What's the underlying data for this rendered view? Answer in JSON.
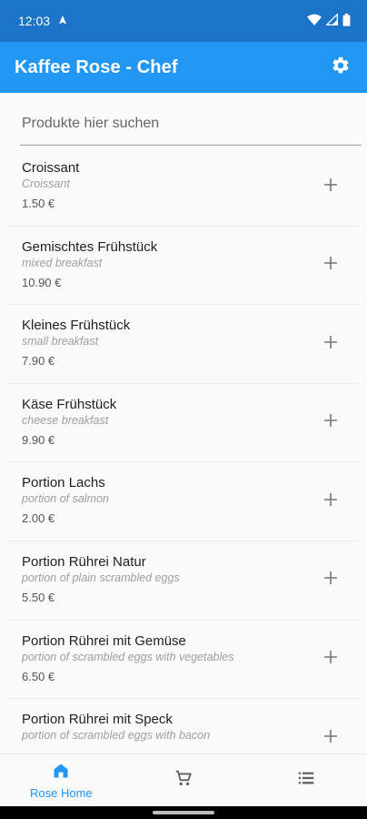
{
  "status_bar": {
    "time": "12:03",
    "icons": [
      "navigation-icon",
      "wifi-icon",
      "signal-icon",
      "battery-icon"
    ]
  },
  "app_bar": {
    "title": "Kaffee Rose - Chef",
    "settings_icon": "gear-icon"
  },
  "search": {
    "placeholder": "Produkte hier suchen",
    "value": ""
  },
  "products": [
    {
      "name": "Croissant",
      "subtitle": "Croissant",
      "price": "1.50 €"
    },
    {
      "name": "Gemischtes Frühstück",
      "subtitle": "mixed breakfast",
      "price": "10.90 €"
    },
    {
      "name": "Kleines Frühstück",
      "subtitle": "small breakfast",
      "price": "7.90 €"
    },
    {
      "name": "Käse Frühstück",
      "subtitle": "cheese breakfast",
      "price": "9.90 €"
    },
    {
      "name": "Portion Lachs",
      "subtitle": "portion of salmon",
      "price": "2.00 €"
    },
    {
      "name": "Portion Rührei Natur",
      "subtitle": "portion of plain scrambled eggs",
      "price": "5.50 €"
    },
    {
      "name": "Portion Rührei mit Gemüse",
      "subtitle": "portion of scrambled eggs with vegetables",
      "price": "6.50 €"
    },
    {
      "name": "Portion Rührei mit Speck",
      "subtitle": "portion of scrambled eggs with bacon",
      "price": ""
    }
  ],
  "bottom_nav": {
    "items": [
      {
        "label": "Rose Home",
        "icon": "home-icon",
        "active": true
      },
      {
        "label": "",
        "icon": "cart-icon",
        "active": false
      },
      {
        "label": "",
        "icon": "list-icon",
        "active": false
      }
    ]
  },
  "colors": {
    "primary": "#2196f3",
    "status_bar": "#1b74c8",
    "background": "#fafafa"
  }
}
